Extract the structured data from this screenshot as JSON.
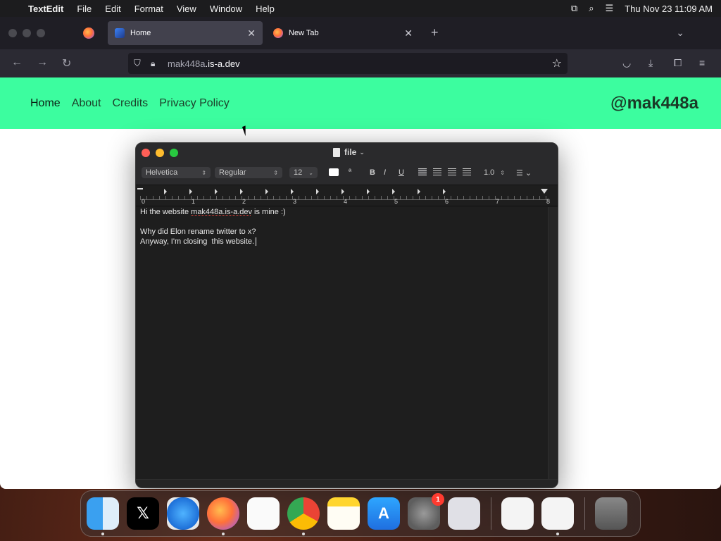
{
  "menubar": {
    "app_name": "TextEdit",
    "items": [
      "File",
      "Edit",
      "Format",
      "View",
      "Window",
      "Help"
    ],
    "datetime": "Thu Nov 23  11:09 AM"
  },
  "browser": {
    "tabs": [
      {
        "label": "Home",
        "active": true
      },
      {
        "label": "New Tab",
        "active": false
      }
    ],
    "url_main": "mak448a",
    "url_rest": ".is-a.dev"
  },
  "website": {
    "nav": [
      "Home",
      "About",
      "Credits",
      "Privacy Policy"
    ],
    "brand": "@mak448a"
  },
  "textedit": {
    "title": "file",
    "toolbar": {
      "font_family": "Helvetica",
      "font_style": "Regular",
      "font_size": "12",
      "line_spacing": "1.0"
    },
    "ruler_numbers": [
      "0",
      "1",
      "2",
      "3",
      "4",
      "5",
      "6",
      "7",
      "8"
    ],
    "lines": {
      "line1_pre": "Hi the website ",
      "line1_link": "mak448a.is-a.dev",
      "line1_post": " is mine :)",
      "line3": "Why did Elon rename twitter to x?",
      "line4": "Anyway, I'm closing  this website."
    }
  },
  "dock": {
    "apps": [
      "finder",
      "x",
      "safari",
      "firefox",
      "reminders",
      "chrome",
      "notes",
      "app-store",
      "system-settings",
      "launchpad",
      "screenshot-utility",
      "textedit",
      "trash"
    ],
    "settings_badge": "1"
  }
}
